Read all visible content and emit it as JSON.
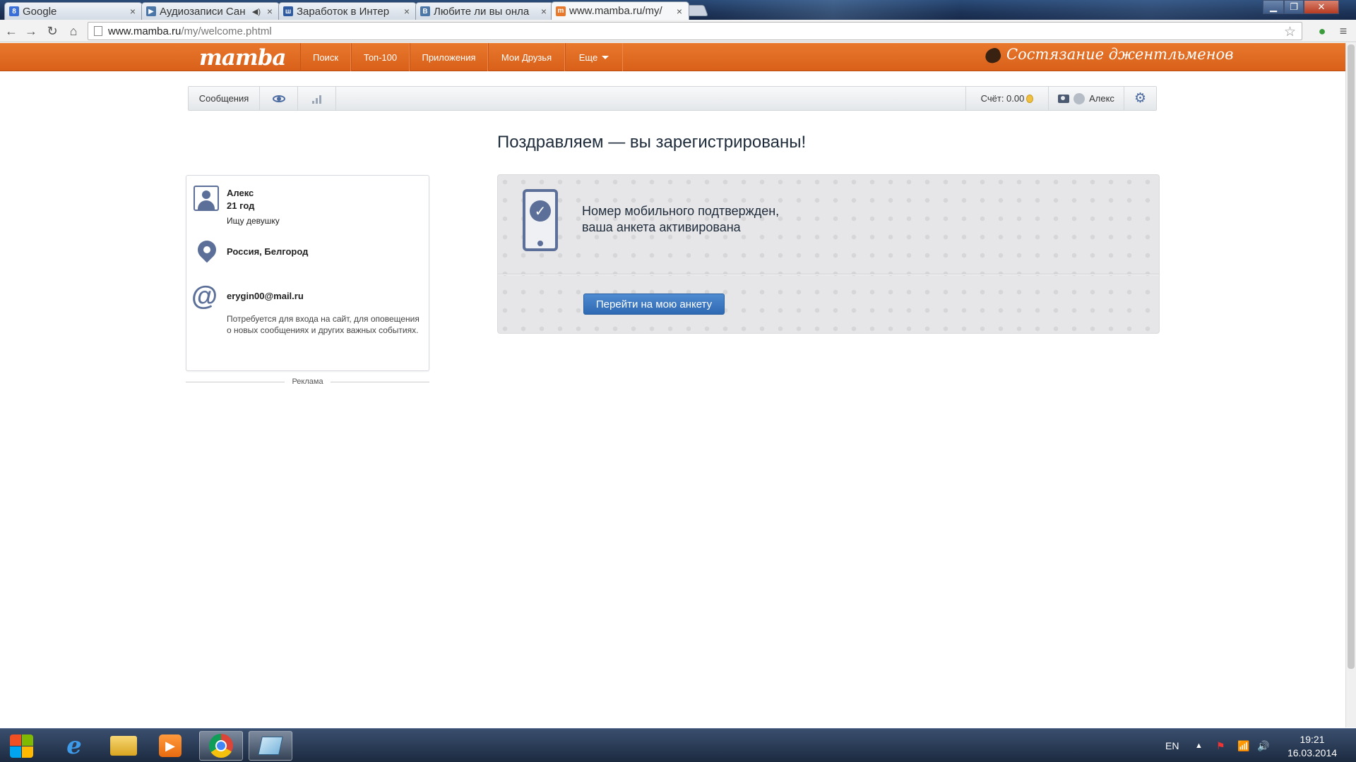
{
  "browser": {
    "tabs": [
      {
        "title": "Google",
        "favicon": "google-icon",
        "color": "#3a6fd8"
      },
      {
        "title": "Аудиозаписи Сан",
        "favicon": "vk-icon",
        "color": "#4a76a8"
      },
      {
        "title": "Заработок в Интер",
        "favicon": "site-icon",
        "color": "#2d5aa0"
      },
      {
        "title": "Любите ли вы онла",
        "favicon": "vk-icon",
        "color": "#4a76a8"
      },
      {
        "title": "www.mamba.ru/my/",
        "favicon": "mamba-icon",
        "color": "#e8782c"
      }
    ],
    "url_host": "www.mamba.ru",
    "url_path": "/my/welcome.phtml"
  },
  "nav": {
    "logo": "mamba",
    "items": [
      "Поиск",
      "Топ-100",
      "Приложения",
      "Мои Друзья",
      "Еще"
    ],
    "slogan": "Состязание джентльменов"
  },
  "userbar": {
    "messages": "Сообщения",
    "balance": "Счёт: 0.00",
    "username": "Алекс"
  },
  "heading": "Поздравляем — вы зарегистрированы!",
  "profile": {
    "name": "Алекс",
    "age": "21 год",
    "seeking": "Ищу девушку",
    "location": "Россия, Белгород",
    "email": "erygin00@mail.ru",
    "email_note": "Потребуется для входа на сайт, для оповещения о новых сообщениях и других важных событиях."
  },
  "ad_label": "Реклама",
  "confirm": {
    "line1": "Номер мобильного подтвержден,",
    "line2": "ваша анкета активирована",
    "button": "Перейти на мою анкету"
  },
  "taskbar": {
    "lang": "EN",
    "time": "19:21",
    "date": "16.03.2014"
  }
}
